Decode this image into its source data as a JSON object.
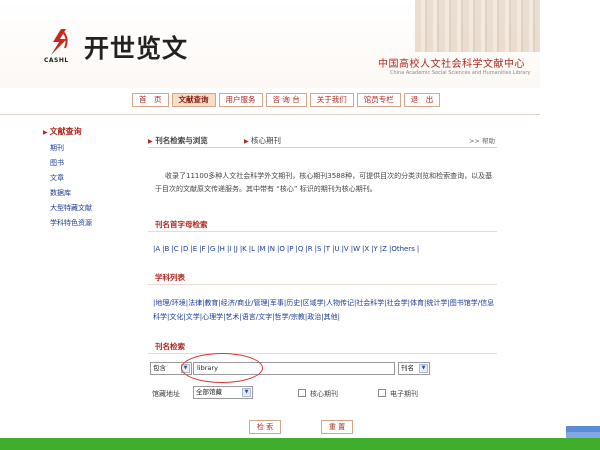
{
  "header": {
    "logo_text": "开世览文",
    "logo_sub": "CASHL",
    "center_name": "中国高校人文社会科学文献中心",
    "center_name_en": "China Academic Social Sciences and Humanities Library"
  },
  "nav": {
    "items": [
      "首　页",
      "文献查询",
      "用户服务",
      "咨 询 台",
      "关于我们",
      "馆员专栏",
      "退　出"
    ],
    "active_index": 1
  },
  "sidebar": {
    "heading": "文献查询",
    "items": [
      "期刊",
      "图书",
      "文章",
      "数据库",
      "大型特藏文献",
      "学科特色资源"
    ]
  },
  "breadcrumb": {
    "section": "刊名检索与浏览",
    "current": "核心期刊",
    "help": ">> 帮助"
  },
  "intro_text": "收录了11100多种人文社会科学外文期刊，核心期刊3588种，可提供目次的分类浏览和检索查询，以及基于目次的文献原文传递服务。其中带有 “核心” 标识的期刊为核心期刊。",
  "letter_section": {
    "title": "刊名首字母检索",
    "letters": [
      "A",
      "B",
      "C",
      "D",
      "E",
      "F",
      "G",
      "H",
      "I",
      "J",
      "K",
      "L",
      "M",
      "N",
      "O",
      "P",
      "Q",
      "R",
      "S",
      "T",
      "U",
      "V",
      "W",
      "X",
      "Y",
      "Z",
      "Others"
    ]
  },
  "subject_section": {
    "title": "学科列表",
    "subjects": [
      "地理/环境",
      "法律",
      "教育",
      "经济/商业/管理",
      "军事",
      "历史",
      "区域学",
      "人物传记",
      "社会科学",
      "社会学",
      "体育",
      "统计学",
      "图书馆学/信息科学",
      "文化",
      "文学",
      "心理学",
      "艺术",
      "语言/文字",
      "哲学/宗教",
      "政治",
      "其他"
    ]
  },
  "search_section": {
    "title": "刊名检索",
    "match_select": "包含",
    "query_value": "library",
    "field_select": "刊名",
    "library_label": "馆藏地址",
    "library_select": "全部馆藏",
    "core_checkbox_label": "核心期刊",
    "electronic_checkbox_label": "电子期刊",
    "search_button": "检 索",
    "reset_button": "重 置"
  },
  "colors": {
    "brand_red": "#b0281f",
    "link_blue": "#1a3a9a",
    "footer_green": "#3fae2a",
    "highlight_circle": "#e03434"
  }
}
